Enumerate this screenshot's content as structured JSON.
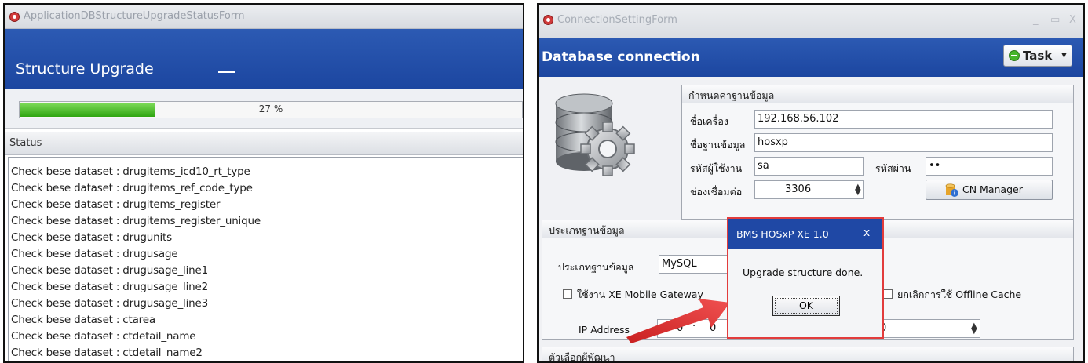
{
  "left_window": {
    "title": "ApplicationDBStructureUpgradeStatusForm",
    "header_title": "Structure Upgrade",
    "progress": {
      "value_percent": 27,
      "text": "27 %"
    },
    "status_header": "Status",
    "status_lines": [
      "Check bese dataset : drugitems_icd10_rt_type",
      "Check bese dataset : drugitems_ref_code_type",
      "Check bese dataset : drugitems_register",
      "Check bese dataset : drugitems_register_unique",
      "Check bese dataset : drugunits",
      "Check bese dataset : drugusage",
      "Check bese dataset : drugusage_line1",
      "Check bese dataset : drugusage_line2",
      "Check bese dataset : drugusage_line3",
      "Check bese dataset : ctarea",
      "Check bese dataset : ctdetail_name",
      "Check bese dataset : ctdetail_name2"
    ],
    "colors": {
      "header_blue": "#1c46a0",
      "progress_green": "#2fa512"
    }
  },
  "right_window": {
    "title": "ConnectionSettingForm",
    "window_controls": {
      "minimize": "_",
      "maximize": "▭",
      "close": "X"
    },
    "header_title": "Database connection",
    "task_button": "Task",
    "db_settings": {
      "group_title": "กำหนดค่าฐานข้อมูล",
      "host_label": "ชื่อเครื่อง",
      "host_value": "192.168.56.102",
      "dbname_label": "ชื่อฐานข้อมูล",
      "dbname_value": "hosxp",
      "user_label": "รหัสผู้ใช้งาน",
      "user_value": "sa",
      "password_label": "รหัสผ่าน",
      "password_value": "••",
      "port_label": "ช่องเชื่อมต่อ",
      "port_value": "3306",
      "cn_manager_button": "CN Manager"
    },
    "db_type": {
      "group_title": "ประเภทฐานข้อมูล",
      "type_label": "ประเภทฐานข้อมูล",
      "type_value": "MySQL",
      "mobile_gateway_label": "ใช้งาน XE Mobile Gateway",
      "offline_cache_label": "ยกเลิกการใช้ Offline Cache",
      "ip_label": "IP Address",
      "ip_part1": "0",
      "ip_part2": "0",
      "port_value": "0"
    },
    "dev_options": {
      "group_title": "ตัวเลือกผู้พัฒนา"
    }
  },
  "dialog": {
    "title": "BMS HOSxP XE 1.0",
    "close": "x",
    "message": "Upgrade structure done.",
    "ok_button": "OK"
  },
  "icons": {
    "app": "app-logo-icon",
    "database": "database-gear-icon",
    "task": "task-green-icon",
    "cn_manager": "database-info-icon",
    "arrow": "red-pointer-arrow"
  },
  "highlight_colors": {
    "dialog_outline": "#e23c3c",
    "arrow": "#e23c3c"
  }
}
